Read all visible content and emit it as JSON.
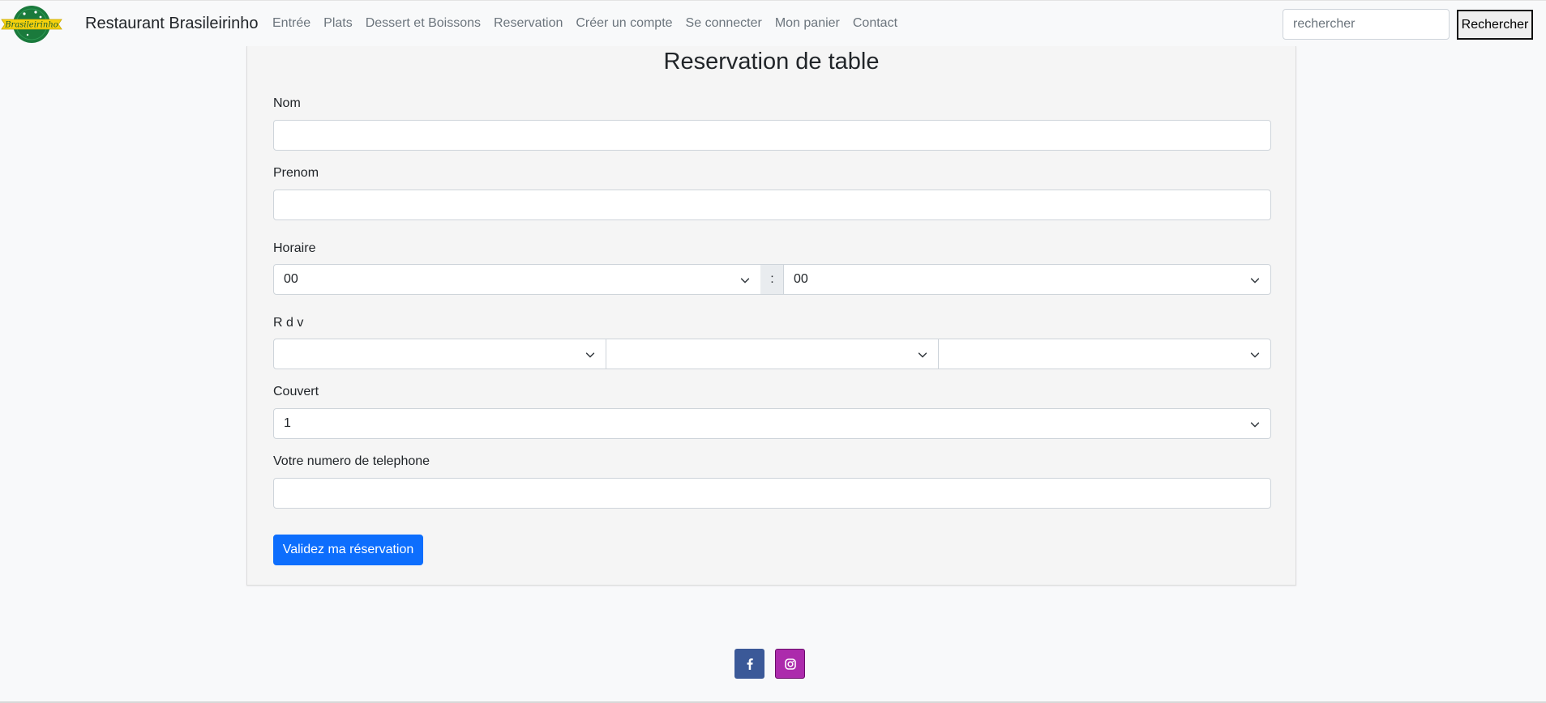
{
  "navbar": {
    "logo_text": "Brasileirinho",
    "brand": "Restaurant Brasileirinho",
    "links": [
      "Entrée",
      "Plats",
      "Dessert et Boissons",
      "Reservation",
      "Créer un compte",
      "Se connecter",
      "Mon panier",
      "Contact"
    ],
    "search_placeholder": "rechercher",
    "search_button": "Rechercher"
  },
  "form": {
    "title": "Reservation de table",
    "nom_label": "Nom",
    "prenom_label": "Prenom",
    "horaire_label": "Horaire",
    "hour_value": "00",
    "time_separator": ":",
    "minute_value": "00",
    "rdv_label": "R d v",
    "rdv_values": [
      "",
      "",
      ""
    ],
    "couvert_label": "Couvert",
    "couvert_value": "1",
    "phone_label": "Votre numero de telephone",
    "submit_label": "Validez ma réservation"
  },
  "footer": {
    "social": [
      "facebook-icon",
      "instagram-icon"
    ]
  },
  "colors": {
    "primary": "#0d6efd",
    "facebook": "#3b5998",
    "instagram": "#ac2bac",
    "logo_green": "#1a7a3c",
    "logo_yellow": "#f5d10d"
  }
}
